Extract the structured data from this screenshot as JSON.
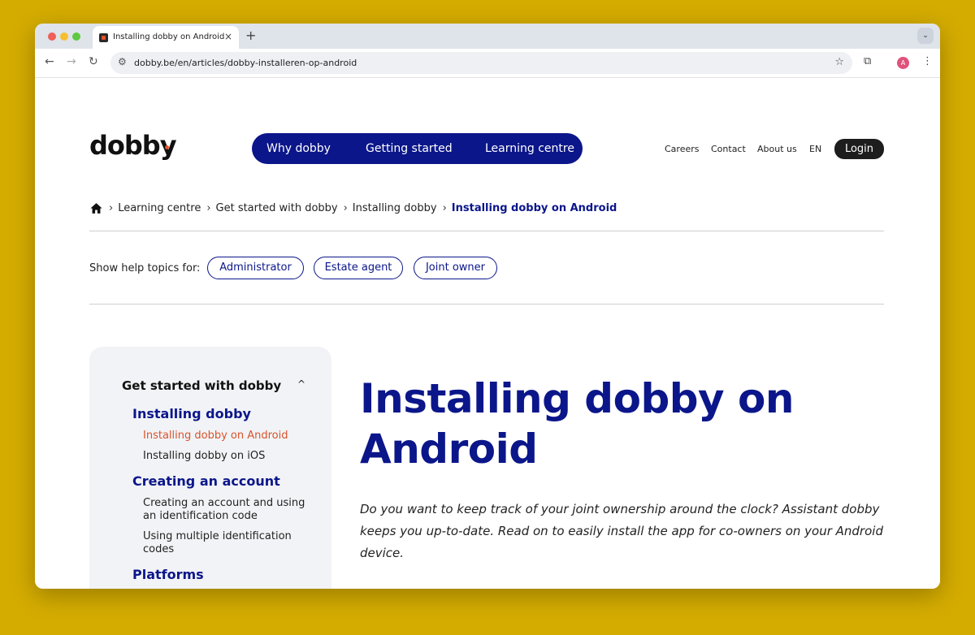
{
  "browser": {
    "tab_title": "Installing dobby on Android",
    "tab_close": "×",
    "new_tab": "+",
    "tab_menu": "⌄",
    "url": "dobby.be/en/articles/dobby-installeren-op-android",
    "profile_initial": "A",
    "icons": {
      "back": "←",
      "forward": "→",
      "reload": "↻",
      "site_info": "⚙",
      "star": "☆",
      "extensions": "⧉",
      "menu": "⋮"
    }
  },
  "site": {
    "logo": "dobby",
    "brand_color": "#0b168a",
    "accent_color": "#e8522b",
    "main_nav": [
      {
        "label": "Why dobby"
      },
      {
        "label": "Getting started"
      },
      {
        "label": "Learning centre"
      }
    ],
    "top_nav": [
      {
        "label": "Careers"
      },
      {
        "label": "Contact"
      },
      {
        "label": "About us"
      },
      {
        "label": "EN"
      }
    ],
    "login_label": "Login"
  },
  "breadcrumb": {
    "home_icon": "home-icon",
    "separator": "›",
    "items": [
      {
        "label": "Learning centre"
      },
      {
        "label": "Get started with dobby"
      },
      {
        "label": "Installing dobby"
      },
      {
        "label": "Installing dobby on Android"
      }
    ]
  },
  "topics": {
    "label": "Show help topics for:",
    "options": [
      {
        "label": "Administrator"
      },
      {
        "label": "Estate agent"
      },
      {
        "label": "Joint owner"
      }
    ]
  },
  "sidebar": {
    "heading": "Get started with dobby",
    "caret": "^",
    "sections": [
      {
        "title": "Installing dobby",
        "links": [
          {
            "label": "Installing dobby on Android"
          },
          {
            "label": "Installing dobby on iOS"
          }
        ]
      },
      {
        "title": "Creating an account",
        "links": [
          {
            "label": "Creating an account and using an identification code"
          },
          {
            "label": "Using multiple identification codes"
          }
        ]
      },
      {
        "title": "Platforms",
        "links": []
      }
    ]
  },
  "article": {
    "title": "Installing dobby on Android",
    "intro": "Do you want to keep track of your joint ownership around the clock? Assistant dobby keeps you up-to-date. Read on to easily install the app for co-owners on your Android device."
  }
}
